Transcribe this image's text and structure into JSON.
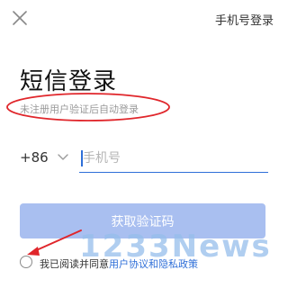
{
  "header": {
    "close_icon": "close-icon",
    "switch_label": "手机号登录"
  },
  "title": "短信登录",
  "subtitle": "未注册用户验证后自动登录",
  "phone": {
    "country_code": "+86",
    "placeholder": "手机号",
    "value": ""
  },
  "code_button": {
    "label": "获取验证码",
    "color": "#a9bff0"
  },
  "agreement": {
    "prefix": "我已阅读并同意",
    "link": "用户协议和隐私政策",
    "checked": false
  },
  "watermark": "1233News",
  "colors": {
    "accent": "#2f6fd8",
    "annotation": "#e0262b"
  }
}
